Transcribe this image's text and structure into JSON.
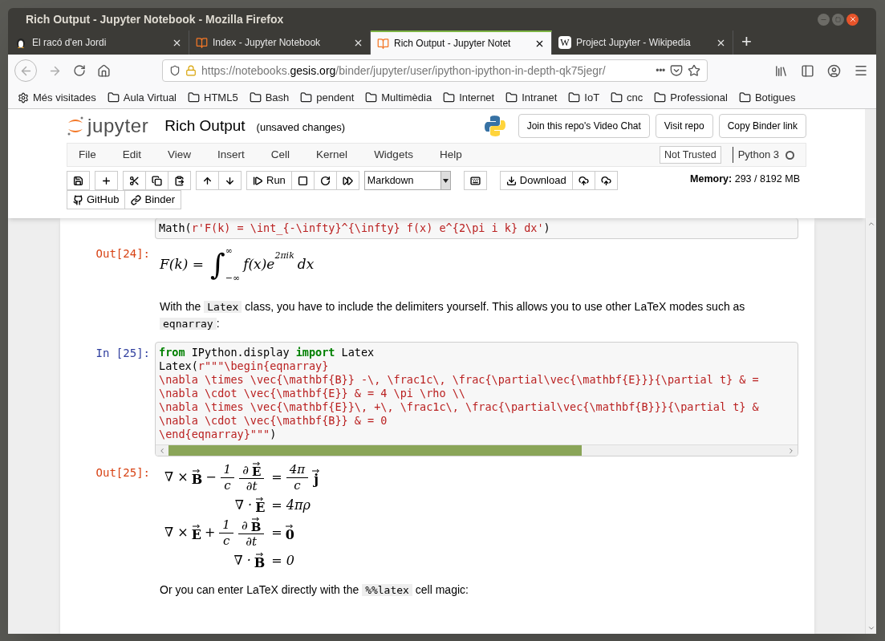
{
  "window": {
    "title": "Rich Output - Jupyter Notebook - Mozilla Firefox"
  },
  "tabs": [
    {
      "label": "El racó d'en Jordi",
      "kind": "penguin",
      "selected": false
    },
    {
      "label": "Index - Jupyter Notebook",
      "kind": "book",
      "selected": false
    },
    {
      "label": "Rich Output - Jupyter Notet",
      "kind": "book",
      "selected": true
    },
    {
      "label": "Project Jupyter - Wikipedia",
      "kind": "wiki",
      "selected": false
    }
  ],
  "wiki_icon_letter": "W",
  "new_tab": "+",
  "address": {
    "pre": "https://notebooks.",
    "host": "gesis.org",
    "post": "/binder/jupyter/user/ipython-ipython-in-depth-qk75jegr/",
    "more": "•••"
  },
  "bookmarks": [
    {
      "label": "Més visitades",
      "kind": "gear"
    },
    {
      "label": "Aula Virtual",
      "kind": "folder"
    },
    {
      "label": "HTML5",
      "kind": "folder"
    },
    {
      "label": "Bash",
      "kind": "folder"
    },
    {
      "label": "pendent",
      "kind": "folder"
    },
    {
      "label": "Multimèdia",
      "kind": "folder"
    },
    {
      "label": "Internet",
      "kind": "folder"
    },
    {
      "label": "Intranet",
      "kind": "folder"
    },
    {
      "label": "IoT",
      "kind": "folder"
    },
    {
      "label": "cnc",
      "kind": "folder"
    },
    {
      "label": "Professional",
      "kind": "folder"
    },
    {
      "label": "Botigues",
      "kind": "folder"
    }
  ],
  "jupyter": {
    "logo_text": "jupyter",
    "notebook_title": "Rich Output",
    "save_status": "(unsaved changes)",
    "header_buttons": [
      "Join this repo's Video Chat",
      "Visit repo",
      "Copy Binder link"
    ],
    "menu": [
      "File",
      "Edit",
      "View",
      "Insert",
      "Cell",
      "Kernel",
      "Widgets",
      "Help"
    ],
    "trust": "Not Trusted",
    "kernel": "Python 3",
    "kernel_busy": false,
    "toolbar": [
      [
        {
          "kind": "save"
        }
      ],
      [
        {
          "kind": "plus"
        }
      ],
      [
        {
          "kind": "cut"
        },
        {
          "kind": "copy"
        },
        {
          "kind": "paste"
        }
      ],
      [
        {
          "kind": "up"
        },
        {
          "kind": "down"
        }
      ],
      [
        {
          "kind": "run",
          "label": "Run"
        },
        {
          "kind": "stop"
        },
        {
          "kind": "restart"
        },
        {
          "kind": "forward"
        }
      ]
    ],
    "cell_type": "Markdown",
    "toolbar2": [
      [
        {
          "kind": "keyboard"
        }
      ],
      [
        {
          "kind": "download",
          "label": "Download"
        },
        {
          "kind": "cloud-up"
        },
        {
          "kind": "cloud-up"
        }
      ]
    ],
    "memory_label": "Memory:",
    "memory_value": "293 / 8192 MB",
    "links": [
      {
        "kind": "github",
        "label": "GitHub"
      },
      {
        "kind": "link",
        "label": "Binder"
      }
    ]
  },
  "cells": [
    {
      "kind": "code",
      "lines": [
        [
          {
            "kind": "plain",
            "s": "Math("
          },
          {
            "kind": "str",
            "s": "r'F(k) = \\int_{-\\infty}^{\\infty} f(x) e^{2\\pi i k} dx'"
          },
          {
            "kind": "plain",
            "s": ")"
          }
        ]
      ]
    },
    {
      "kind": "integral",
      "prompt": "Out[24]:",
      "lhs": "F(k) =",
      "sign": "∫",
      "upper": "∞",
      "lower": "−∞",
      "body": "f(x)e",
      "sup": "2πik",
      "tail": "dx"
    },
    {
      "kind": "markdown",
      "parts": [
        {
          "kind": "text",
          "s": "With the "
        },
        {
          "kind": "code",
          "s": "Latex"
        },
        {
          "kind": "text",
          "s": " class, you have to include the delimiters yourself. This allows you to use other LaTeX modes such as "
        },
        {
          "kind": "code",
          "s": "eqnarray"
        },
        {
          "kind": "text",
          "s": ":"
        }
      ]
    },
    {
      "kind": "code",
      "prompt": "In [25]:",
      "scroll": true,
      "lines": [
        [
          {
            "kind": "kw",
            "s": "from"
          },
          {
            "kind": "plain",
            "s": " IPython.display "
          },
          {
            "kind": "kw",
            "s": "import"
          },
          {
            "kind": "plain",
            "s": " Latex"
          }
        ],
        [
          {
            "kind": "plain",
            "s": "Latex("
          },
          {
            "kind": "str",
            "s": "r\"\"\"\\begin{eqnarray}"
          }
        ],
        [
          {
            "kind": "str",
            "s": "\\nabla \\times \\vec{\\mathbf{B}} -\\, \\frac1c\\, \\frac{\\partial\\vec{\\mathbf{E}}}{\\partial t} & ="
          }
        ],
        [
          {
            "kind": "str",
            "s": "\\nabla \\cdot \\vec{\\mathbf{E}} & = 4 \\pi \\rho \\\\"
          }
        ],
        [
          {
            "kind": "str",
            "s": "\\nabla \\times \\vec{\\mathbf{E}}\\, +\\, \\frac1c\\, \\frac{\\partial\\vec{\\mathbf{B}}}{\\partial t} &"
          }
        ],
        [
          {
            "kind": "str",
            "s": "\\nabla \\cdot \\vec{\\mathbf{B}} & = 0"
          }
        ],
        [
          {
            "kind": "str",
            "s": "\\end{eqnarray}\"\"\""
          },
          {
            "kind": "plain",
            "s": ")"
          }
        ]
      ]
    },
    {
      "kind": "eqnarray",
      "prompt": "Out[25]:",
      "rows": [
        {
          "left": [
            {
              "kind": "text",
              "s": "∇ ×"
            },
            {
              "kind": "vec",
              "s": "B"
            },
            {
              "kind": "text",
              "s": "−"
            },
            {
              "kind": "frac",
              "num": [
                {
                  "kind": "text",
                  "s": "1"
                }
              ],
              "den": [
                {
                  "kind": "text",
                  "s": "c"
                }
              ]
            },
            {
              "kind": "frac",
              "num": [
                {
                  "kind": "text",
                  "s": "∂"
                },
                {
                  "kind": "vec",
                  "s": "E"
                }
              ],
              "den": [
                {
                  "kind": "text",
                  "s": "∂t"
                }
              ]
            }
          ],
          "right": [
            {
              "kind": "text",
              "s": "="
            },
            {
              "kind": "frac",
              "num": [
                {
                  "kind": "text",
                  "s": "4π"
                }
              ],
              "den": [
                {
                  "kind": "text",
                  "s": "c"
                }
              ]
            },
            {
              "kind": "vec",
              "s": "j"
            }
          ]
        },
        {
          "left": [
            {
              "kind": "text",
              "s": "∇ ·"
            },
            {
              "kind": "vec",
              "s": "E"
            }
          ],
          "right": [
            {
              "kind": "text",
              "s": "= 4πρ"
            }
          ]
        },
        {
          "left": [
            {
              "kind": "text",
              "s": "∇ ×"
            },
            {
              "kind": "vec",
              "s": "E"
            },
            {
              "kind": "text",
              "s": "+"
            },
            {
              "kind": "frac",
              "num": [
                {
                  "kind": "text",
                  "s": "1"
                }
              ],
              "den": [
                {
                  "kind": "text",
                  "s": "c"
                }
              ]
            },
            {
              "kind": "frac",
              "num": [
                {
                  "kind": "text",
                  "s": "∂"
                },
                {
                  "kind": "vec",
                  "s": "B"
                }
              ],
              "den": [
                {
                  "kind": "text",
                  "s": "∂t"
                }
              ]
            }
          ],
          "right": [
            {
              "kind": "text",
              "s": "="
            },
            {
              "kind": "vec",
              "s": "0"
            }
          ]
        },
        {
          "left": [
            {
              "kind": "text",
              "s": "∇ ·"
            },
            {
              "kind": "vec",
              "s": "B"
            }
          ],
          "right": [
            {
              "kind": "text",
              "s": "= 0"
            }
          ]
        }
      ]
    },
    {
      "kind": "markdown",
      "parts": [
        {
          "kind": "text",
          "s": "Or you can enter LaTeX directly with the "
        },
        {
          "kind": "code",
          "s": "%%latex"
        },
        {
          "kind": "text",
          "s": " cell magic:"
        }
      ]
    }
  ]
}
